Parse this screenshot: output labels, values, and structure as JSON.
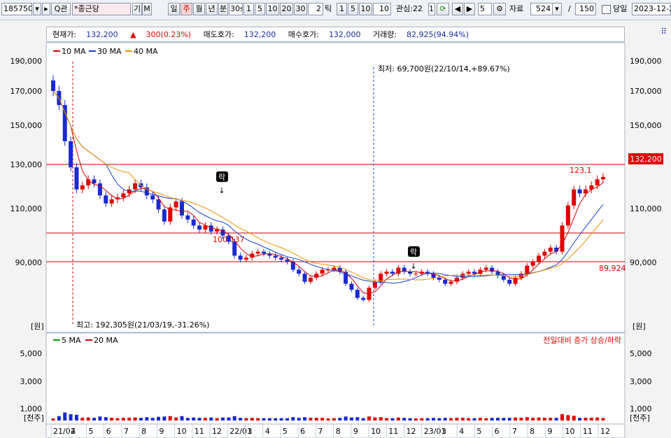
{
  "toolbar": {
    "code": "185750",
    "search_label": "Q관",
    "stock_name": "*종근당",
    "gi": "기",
    "m": "M",
    "periods": [
      "일",
      "주",
      "월",
      "년",
      "분"
    ],
    "active_period": "주",
    "minute_value": "30s",
    "minute_opts": [
      "1",
      "5",
      "10",
      "20",
      "30"
    ],
    "tick_value": "2",
    "tick_label": "틱",
    "tick_opts": [
      "1",
      "5",
      "10"
    ],
    "tick_value2": "10",
    "interest_label": "관심:22",
    "interest_num": "1",
    "step_value": "5",
    "data_label": "자료",
    "data_count": "524",
    "slash": "/",
    "total_count": "150",
    "same_day_label": "당일",
    "date": "2023-12-2"
  },
  "info": {
    "current_label": "현재가:",
    "current_price": "132,200",
    "change": "300(0.23%)",
    "ask_label": "매도호가:",
    "ask": "132,200",
    "bid_label": "매수호가:",
    "bid": "132,000",
    "volume_label": "거래량:",
    "volume": "82,925(94.94%)"
  },
  "colors": {
    "up": "#e00000",
    "down": "#1a2ad0",
    "ma10": "#d40000",
    "ma30": "#1a40d0",
    "ma40": "#f09000",
    "vol_ma5": "#00a000",
    "vol_ma20": "#d40000"
  },
  "chart_data": [
    {
      "type": "candlestick",
      "legend": [
        "10 MA",
        "30 MA",
        "40 MA"
      ],
      "y_ticks": [
        "190,000",
        "170,000",
        "150,000",
        "130,000",
        "110,000",
        "90,000"
      ],
      "y_unit": "[원]",
      "x_ticks": [
        "21/02",
        "4",
        "5",
        "6",
        "7",
        "8",
        "9",
        "10",
        "11",
        "12",
        "22/01",
        "3",
        "4",
        "5",
        "6",
        "7",
        "8",
        "9",
        "10",
        "11",
        "12",
        "23/01",
        "3",
        "4",
        "5",
        "6",
        "7",
        "8",
        "9",
        "10",
        "11",
        "12"
      ],
      "ylim": [
        70000,
        195000
      ],
      "hlines": [
        130000,
        100000,
        90000
      ],
      "annotations": {
        "high": "최고: 192,305원(21/03/19,-31.26%)",
        "low": "최저: 69,700원(22/10/14,+89.67%)",
        "price_100": "100,137",
        "price_right_low": "89,924",
        "price_right_high": "123,1",
        "last_price_tag": "132,200",
        "rak1": "락",
        "rak2": "락"
      },
      "close": [
        175000,
        168000,
        150000,
        137000,
        126000,
        128000,
        131000,
        129000,
        123000,
        119000,
        121000,
        122000,
        124000,
        126000,
        129000,
        127000,
        123000,
        121000,
        116000,
        110000,
        117000,
        120000,
        113000,
        111000,
        108000,
        106000,
        108000,
        105000,
        106000,
        103000,
        100000,
        93000,
        91000,
        92000,
        94000,
        95000,
        94000,
        93000,
        92000,
        91000,
        90000,
        86000,
        84000,
        80000,
        82000,
        84000,
        86000,
        86000,
        87000,
        85000,
        79000,
        76000,
        72000,
        71000,
        77000,
        80000,
        84000,
        85000,
        84000,
        87000,
        85000,
        84000,
        84000,
        85000,
        84000,
        82000,
        81000,
        79000,
        80000,
        82000,
        84000,
        85000,
        84000,
        86000,
        87000,
        85000,
        83000,
        81000,
        79000,
        82000,
        84000,
        88000,
        90000,
        93000,
        95000,
        97000,
        95000,
        108000,
        118000,
        126000,
        124000,
        126000,
        128000,
        131000,
        132200
      ]
    },
    {
      "type": "volume",
      "legend": [
        "5 MA",
        "20 MA"
      ],
      "legend_right": "전일대비 증가 상승/하락",
      "y_ticks": [
        "5,000",
        "3,000",
        "1,000"
      ],
      "y_unit": "[천주]",
      "ylim": [
        0,
        6000
      ]
    }
  ]
}
